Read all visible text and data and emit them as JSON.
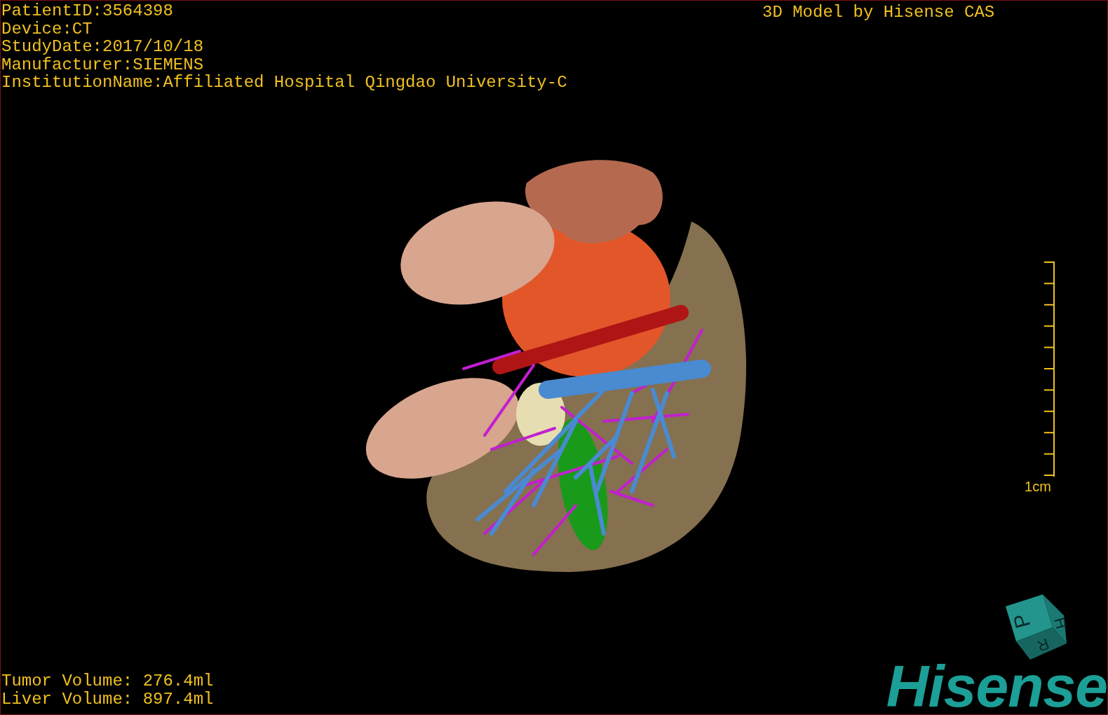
{
  "patient_info": [
    "PatientID:3564398",
    "Device:CT",
    "StudyDate:2017/10/18",
    "Manufacturer:SIEMENS",
    "InstitutionName:Affiliated Hospital Qingdao University-C"
  ],
  "title": "3D Model by Hisense CAS",
  "scale_bar": {
    "label": "1cm"
  },
  "orientation_cube": {
    "labels": [
      "P",
      "H",
      "R"
    ]
  },
  "logo": "Hisense",
  "volumes": [
    "Tumor Volume: 276.4ml",
    "Liver Volume: 897.4ml"
  ]
}
